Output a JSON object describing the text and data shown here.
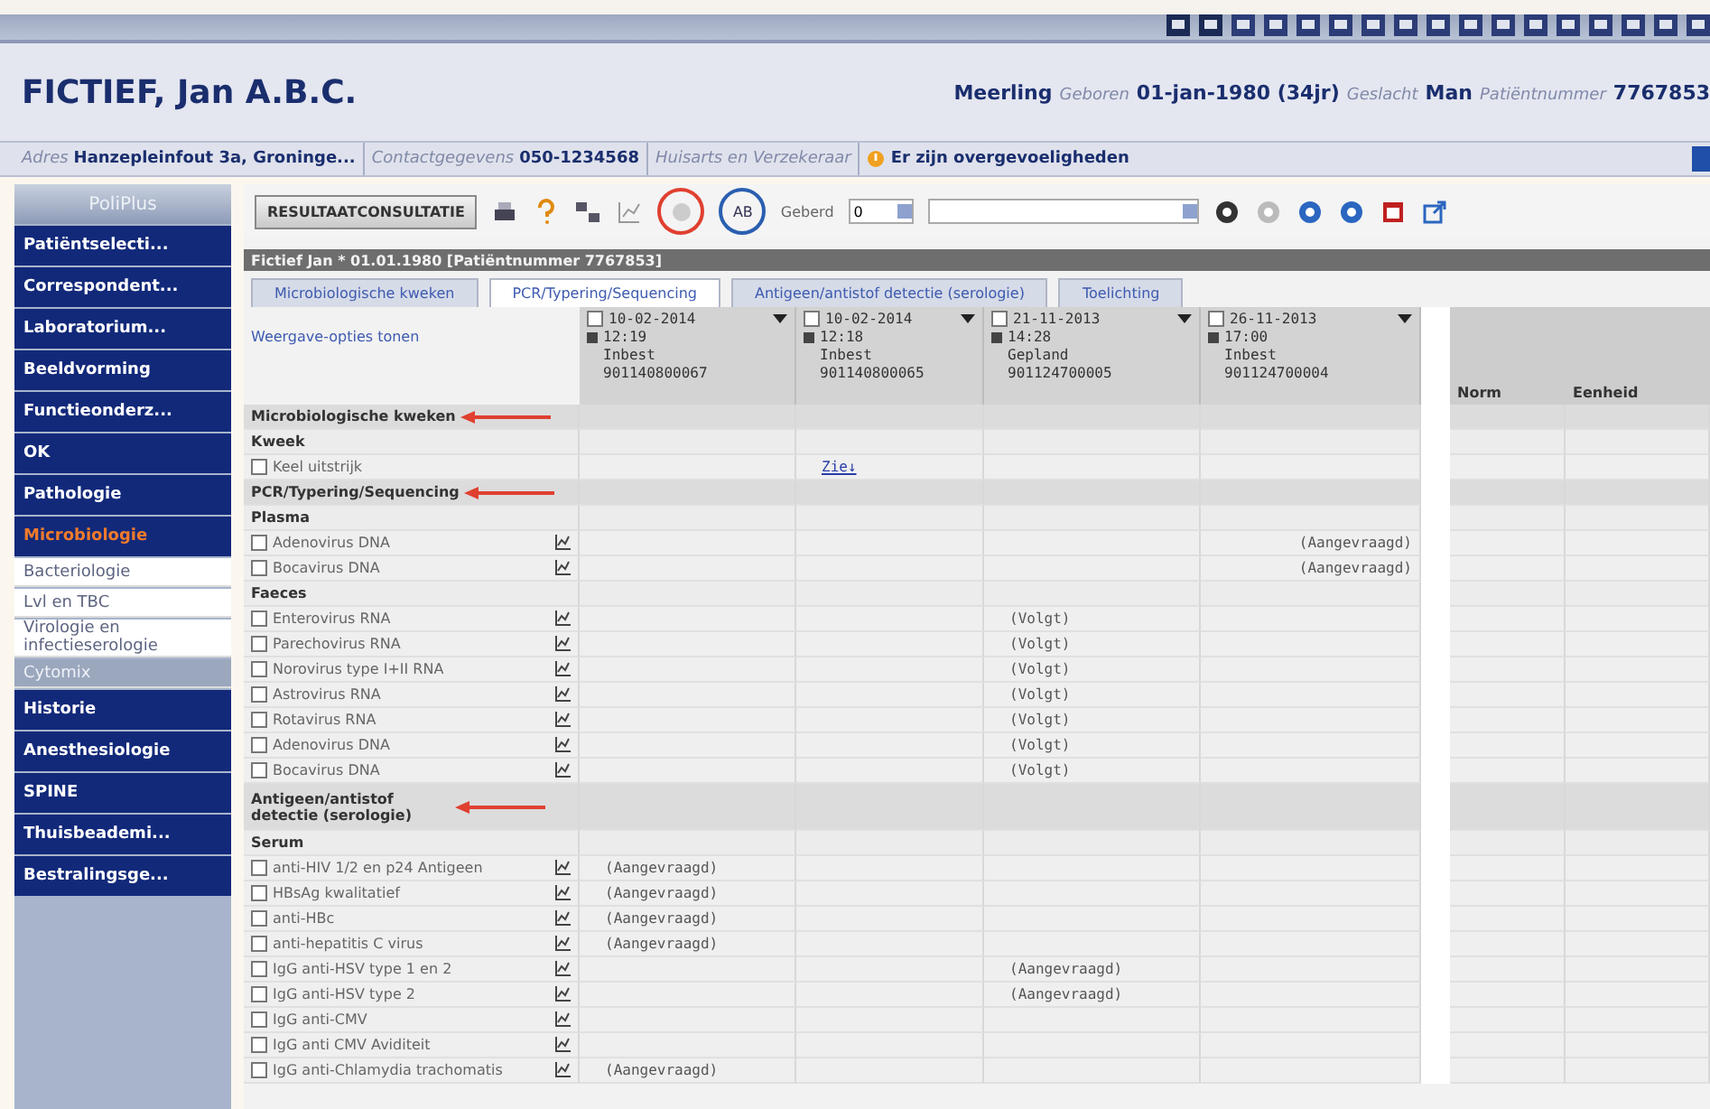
{
  "patient": {
    "name": "FICTIEF, Jan A.B.C.",
    "fields": [
      {
        "value": "Meerling"
      },
      {
        "label": "Geboren",
        "value": "01-jan-1980 (34jr)"
      },
      {
        "label": "Geslacht",
        "value": "Man"
      },
      {
        "label": "Patiëntnummer",
        "value": "7767853"
      }
    ]
  },
  "info_bar": [
    {
      "kind": "field",
      "label": "Adres",
      "value": "Hanzepleinfout 3a, Groninge..."
    },
    {
      "kind": "field",
      "label": "Contactgegevens",
      "value": "050-1234568"
    },
    {
      "kind": "field",
      "label": "Huisarts en Verzekeraar"
    },
    {
      "kind": "warning",
      "value": "Er zijn overgevoeligheden"
    }
  ],
  "sidebar": {
    "title": "PoliPlus",
    "items": [
      {
        "kind": "module",
        "label": "Patiëntselecti...",
        "selected": false
      },
      {
        "kind": "module",
        "label": "Correspondent...",
        "selected": false
      },
      {
        "kind": "module",
        "label": "Laboratorium...",
        "selected": false
      },
      {
        "kind": "module",
        "label": "Beeldvorming",
        "selected": false
      },
      {
        "kind": "module",
        "label": "Functieonderz...",
        "selected": false
      },
      {
        "kind": "module",
        "label": "OK",
        "selected": false
      },
      {
        "kind": "module",
        "label": "Pathologie",
        "selected": false
      },
      {
        "kind": "module",
        "label": "Microbiologie",
        "selected": true
      },
      {
        "kind": "sub",
        "label": "Bacteriologie",
        "selected": false
      },
      {
        "kind": "sub",
        "label": "Lvl en TBC",
        "selected": false
      },
      {
        "kind": "sub",
        "label": "Virologie en infectieserologie",
        "selected": false
      },
      {
        "kind": "sub",
        "label": "Cytomix",
        "selected": true
      },
      {
        "kind": "module",
        "label": "Historie",
        "selected": false
      },
      {
        "kind": "module",
        "label": "Anesthesiologie",
        "selected": false
      },
      {
        "kind": "module",
        "label": "SPINE",
        "selected": false
      },
      {
        "kind": "module",
        "label": "Thuisbeademi...",
        "selected": false
      },
      {
        "kind": "module",
        "label": "Bestralingsge...",
        "selected": false
      }
    ]
  },
  "toolbar": {
    "button": "RESULTAATCONSULTATIE",
    "ab": "AB",
    "filter_label": "Geberd",
    "filter_value": "0"
  },
  "patient_banner": "Fictief Jan * 01.01.1980  [Patiëntnummer 7767853]",
  "tabs": [
    {
      "label": "Microbiologische kweken",
      "selected": false
    },
    {
      "label": "PCR/Typering/Sequencing",
      "selected": true
    },
    {
      "label": "Antigeen/antistof detectie (serologie)",
      "selected": false
    },
    {
      "label": "Toelichting",
      "selected": false
    }
  ],
  "options_link": "Weergave-opties tonen",
  "columns": [
    {
      "date": "10-02-2014",
      "time": "12:19",
      "status": "Inbest",
      "number": "901140800067",
      "checked": false
    },
    {
      "date": "10-02-2014",
      "time": "12:18",
      "status": "Inbest",
      "number": "901140800065",
      "checked": false
    },
    {
      "date": "21-11-2013",
      "time": "14:28",
      "status": "Gepland",
      "number": "901124700005",
      "checked": false
    },
    {
      "date": "26-11-2013",
      "time": "17:00",
      "status": "Inbest",
      "number": "901124700004",
      "checked": false
    }
  ],
  "extra_columns": [
    "Norm",
    "Eenheid"
  ],
  "rows": [
    {
      "kind": "section",
      "label": "Microbiologische kweken",
      "arrow": true
    },
    {
      "kind": "group",
      "label": "Kweek"
    },
    {
      "kind": "item",
      "label": "Keel uitstrijk",
      "checked": false,
      "graph": false,
      "c2": "Zie↓",
      "c2_link": true
    },
    {
      "kind": "section",
      "label": "PCR/Typering/Sequencing",
      "arrow": true
    },
    {
      "kind": "group",
      "label": "Plasma"
    },
    {
      "kind": "item",
      "label": "Adenovirus DNA",
      "checked": false,
      "graph": true,
      "c4": "(Aangevraagd)"
    },
    {
      "kind": "item",
      "label": "Bocavirus DNA",
      "checked": false,
      "graph": true,
      "c4": "(Aangevraagd)"
    },
    {
      "kind": "group",
      "label": "Faeces"
    },
    {
      "kind": "item",
      "label": "Enterovirus RNA",
      "checked": false,
      "graph": true,
      "c3": "(Volgt)"
    },
    {
      "kind": "item",
      "label": "Parechovirus RNA",
      "checked": false,
      "graph": true,
      "c3": "(Volgt)"
    },
    {
      "kind": "item",
      "label": "Norovirus type I+II RNA",
      "checked": false,
      "graph": true,
      "c3": "(Volgt)"
    },
    {
      "kind": "item",
      "label": "Astrovirus RNA",
      "checked": false,
      "graph": true,
      "c3": "(Volgt)"
    },
    {
      "kind": "item",
      "label": "Rotavirus RNA",
      "checked": false,
      "graph": true,
      "c3": "(Volgt)"
    },
    {
      "kind": "item",
      "label": "Adenovirus DNA",
      "checked": false,
      "graph": true,
      "c3": "(Volgt)"
    },
    {
      "kind": "item",
      "label": "Bocavirus DNA",
      "checked": false,
      "graph": true,
      "c3": "(Volgt)"
    },
    {
      "kind": "section",
      "label": "Antigeen/antistof detectie (serologie)",
      "arrow": true
    },
    {
      "kind": "group",
      "label": "Serum"
    },
    {
      "kind": "item",
      "label": "anti-HIV 1/2 en p24 Antigeen",
      "checked": false,
      "graph": true,
      "c1": "(Aangevraagd)"
    },
    {
      "kind": "item",
      "label": "HBsAg kwalitatief",
      "checked": false,
      "graph": true,
      "c1": "(Aangevraagd)"
    },
    {
      "kind": "item",
      "label": "anti-HBc",
      "checked": false,
      "graph": true,
      "c1": "(Aangevraagd)"
    },
    {
      "kind": "item",
      "label": "anti-hepatitis C virus",
      "checked": false,
      "graph": true,
      "c1": "(Aangevraagd)"
    },
    {
      "kind": "item",
      "label": "IgG anti-HSV type 1 en 2",
      "checked": false,
      "graph": true,
      "c3": "(Aangevraagd)"
    },
    {
      "kind": "item",
      "label": "IgG anti-HSV type 2",
      "checked": false,
      "graph": true,
      "c3": "(Aangevraagd)"
    },
    {
      "kind": "item",
      "label": "IgG anti-CMV",
      "checked": false,
      "graph": true
    },
    {
      "kind": "item",
      "label": "IgG anti CMV Aviditeit",
      "checked": false,
      "graph": true
    },
    {
      "kind": "item",
      "label": "IgG anti-Chlamydia trachomatis",
      "checked": false,
      "graph": true,
      "c1": "(Aangevraagd)"
    }
  ]
}
